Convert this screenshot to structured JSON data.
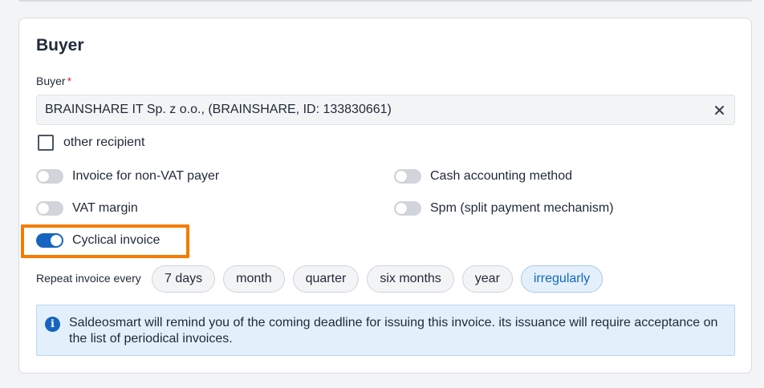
{
  "buyer_section": {
    "title": "Buyer",
    "buyer_field": {
      "label": "Buyer",
      "required_mark": "*",
      "value": "BRAINSHARE IT Sp. z o.o., (BRAINSHARE, ID: 133830661)",
      "clear_icon": "close-icon"
    },
    "other_recipient": {
      "label": "other recipient",
      "checked": false
    },
    "toggles": [
      {
        "label": "Invoice for non-VAT payer",
        "on": false
      },
      {
        "label": "Cash accounting method",
        "on": false
      },
      {
        "label": "VAT margin",
        "on": false
      },
      {
        "label": "Spm (split payment mechanism)",
        "on": false
      },
      {
        "label": "Cyclical invoice",
        "on": true
      }
    ],
    "repeat": {
      "label": "Repeat invoice every",
      "options": [
        "7 days",
        "month",
        "quarter",
        "six months",
        "year",
        "irregularly"
      ],
      "selected": "irregularly"
    },
    "info": {
      "icon": "info-icon",
      "text": "Saldeosmart will remind you of the coming deadline for issuing this invoice. its issuance will require acceptance on the list of periodical invoices."
    }
  },
  "colors": {
    "accent": "#1565c0",
    "highlight": "#f57c00",
    "info_bg": "#e3f0fc",
    "required": "#d32f2f"
  }
}
